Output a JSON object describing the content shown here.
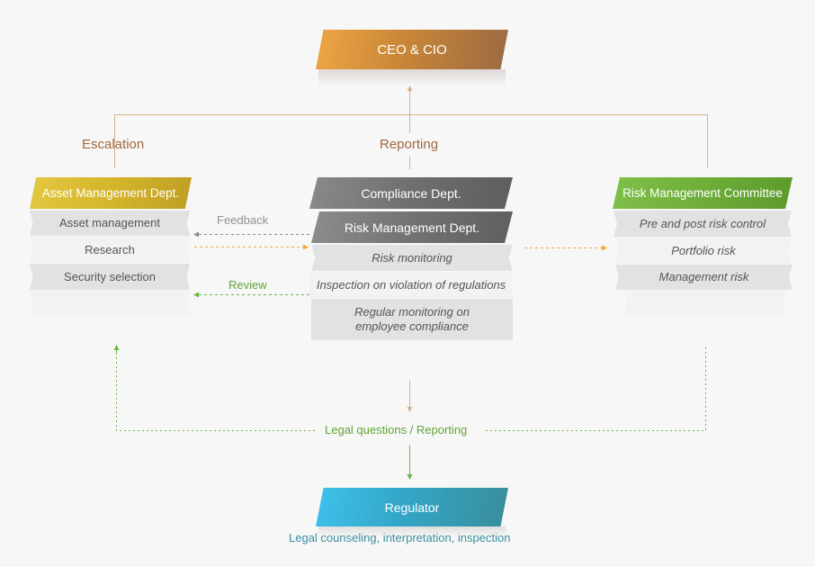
{
  "colors": {
    "connector_brown": "#d4b28a",
    "feedback_grey": "#8a8a8a",
    "flow_orange": "#f0a93a",
    "review_green": "#6cb644",
    "ceo": "#c98637",
    "asset_dept": "#d5b52a",
    "compliance": "#6f6f6f",
    "committee": "#6eae39",
    "regulator": "#33a6c7"
  },
  "ceo": {
    "label": "CEO & CIO"
  },
  "labels": {
    "escalation": "Escalation",
    "reporting": "Reporting",
    "feedback": "Feedback",
    "review": "Review",
    "legal_reporting": "Legal questions / Reporting",
    "regulator_caption": "Legal counseling, interpretation, inspection"
  },
  "asset_dept": {
    "title": "Asset Management Dept.",
    "items": [
      "Asset management",
      "Research",
      "Security selection",
      ""
    ]
  },
  "compliance": {
    "title": "Compliance Dept.",
    "sub_title": "Risk Management Dept.",
    "items": [
      "Risk monitoring",
      "Inspection on violation of regulations",
      "Regular monitoring on employee compliance"
    ]
  },
  "committee": {
    "title": "Risk Management Committee",
    "items": [
      "Pre and post risk control",
      "Portfolio risk",
      "Management risk",
      ""
    ]
  },
  "regulator": {
    "label": "Regulator"
  }
}
